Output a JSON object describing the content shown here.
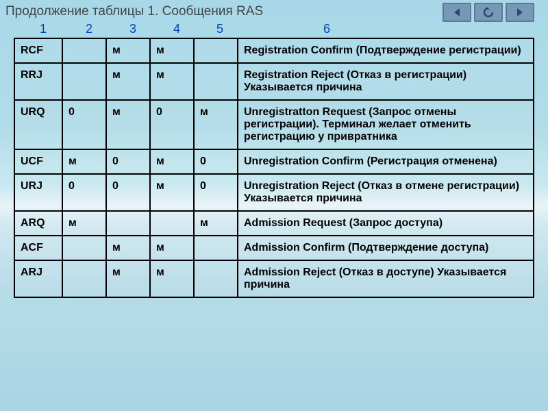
{
  "title": "Продолжение таблицы 1. Сообщения RAS",
  "columnNumbers": [
    "1",
    "2",
    "3",
    "4",
    "5",
    "6"
  ],
  "rows": [
    {
      "code": "RCF",
      "c1": "",
      "c2": "м",
      "c3": "м",
      "c4": "",
      "desc": "Registration Confirm (Подтверждение регистрации)"
    },
    {
      "code": "RRJ",
      "c1": "",
      "c2": "м",
      "c3": "м",
      "c4": "",
      "desc": "Registration Reject (Отказ в регистрации) Указывается причина"
    },
    {
      "code": "URQ",
      "c1": "0",
      "c2": "м",
      "c3": "0",
      "c4": "м",
      "desc": "Unregistratton Request (Запрос отмены регистрации). Терминал желает отменить регистрацию у привратника"
    },
    {
      "code": "UCF",
      "c1": "м",
      "c2": "0",
      "c3": "м",
      "c4": "0",
      "desc": "Unregistration Confirm (Регистрация отменена)"
    },
    {
      "code": "URJ",
      "c1": "0",
      "c2": "0",
      "c3": "м",
      "c4": "0",
      "desc": "Unregistration Reject (Отказ в отмене регистрации) Указывается причина"
    },
    {
      "code": "ARQ",
      "c1": "м",
      "c2": "",
      "c3": "",
      "c4": "м",
      "desc": "Admission Request (Запрос доступа)"
    },
    {
      "code": "ACF",
      "c1": "",
      "c2": "м",
      "c3": "м",
      "c4": "",
      "desc": "Admission Confirm (Подтверждение доступа)"
    },
    {
      "code": "ARJ",
      "c1": "",
      "c2": "м",
      "c3": "м",
      "c4": "",
      "desc": "Admission Reject (Отказ в доступе) Указывается причина"
    }
  ]
}
